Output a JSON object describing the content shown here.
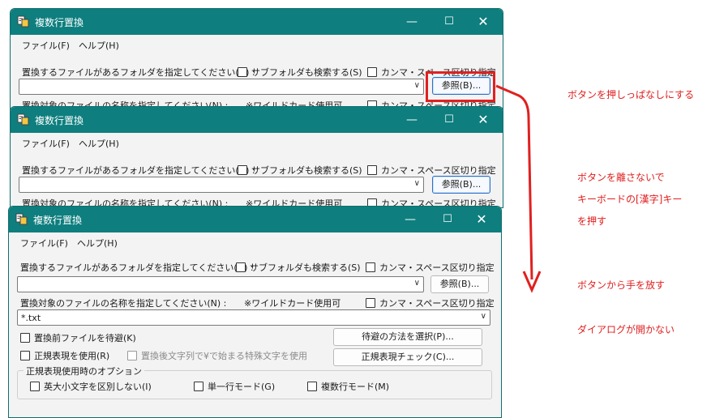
{
  "window": {
    "title": "複数行置換",
    "min_glyph": "—",
    "max_glyph": "☐",
    "close_glyph": "✕",
    "menu": [
      "ファイル(F)",
      "ヘルプ(H)"
    ]
  },
  "form": {
    "folder_label": "置換するファイルがあるフォルダを指定してください(D) :",
    "subfolder_label": "サブフォルダも検索する(S)",
    "comma_label": "カンマ・スペース区切り指定",
    "folder_value": "",
    "browse_label": "参照(B)...",
    "filename_label": "置換対象のファイルの名称を指定してください(N) :",
    "wildcard_note": "※ワイルドカード使用可",
    "filename_value": "*.txt",
    "backup_label": "置換前ファイルを待避(K)",
    "backup_method_label": "待避の方法を選択(P)...",
    "regex_label": "正規表現を使用(R)",
    "yen_label": "置換後文字列で¥で始まる特殊文字を使用",
    "regex_check_label": "正規表現チェック(C)...",
    "regex_options_title": "正規表現使用時のオプション",
    "ignore_case_label": "英大小文字を区別しない(I)",
    "single_line_label": "単一行モード(G)",
    "multi_line_label": "複数行モード(M)"
  },
  "annotations": {
    "step1": "ボタンを押しっぱなしにする",
    "step2_line1": "ボタンを離さないで",
    "step2_line2": "キーボードの[漢字]キー",
    "step2_line3": "を押す",
    "step3": "ボタンから手を放す",
    "step4": "ダイアログが開かない"
  },
  "colors": {
    "titlebar": "#0e7e7e",
    "annotation": "#e02020"
  }
}
